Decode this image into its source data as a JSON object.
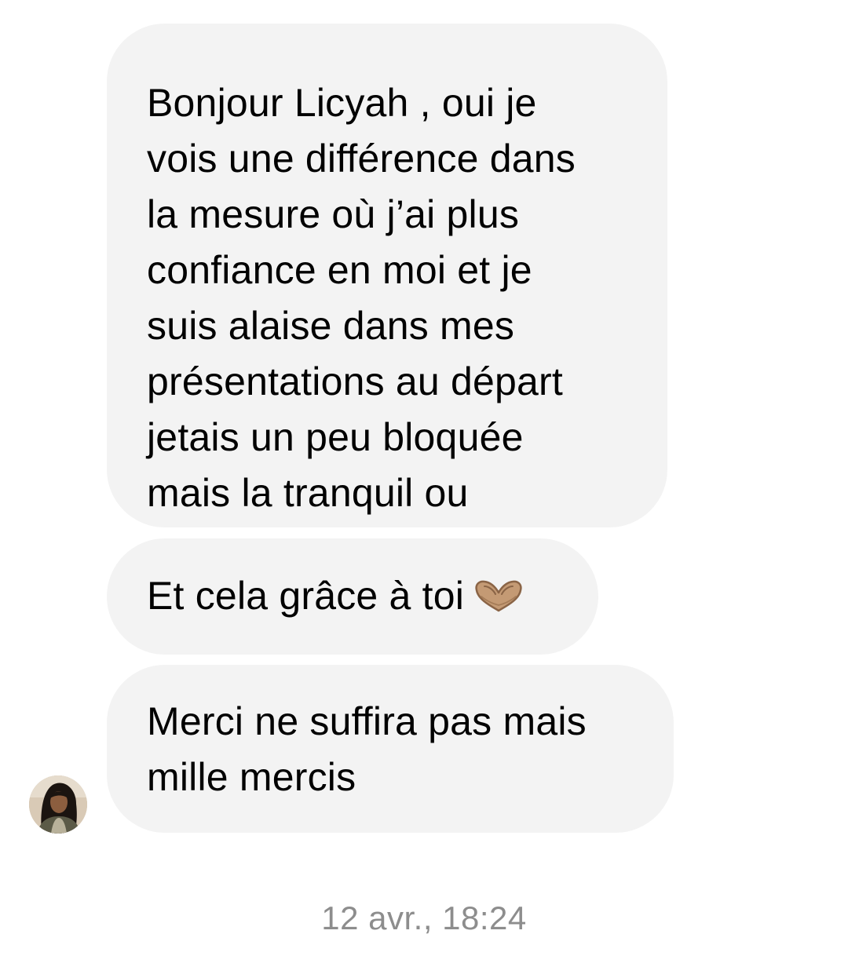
{
  "messages": [
    {
      "lines": [
        "Bonjour Licyah , oui je",
        "vois une différence dans",
        "la mesure où j’ai plus",
        "confiance en moi et je",
        "suis alaise dans mes",
        "présentations au départ",
        "jetais un peu bloquée",
        "mais la tranquil ou"
      ]
    },
    {
      "text": "Et cela grâce à toi",
      "icon": "heart-hands-icon"
    },
    {
      "lines": [
        "Merci ne suffira pas mais",
        "mille mercis"
      ]
    }
  ],
  "timestamp": "12 avr., 18:24",
  "colors": {
    "bubble_background": "#f3f3f3",
    "timestamp_text": "#8d8d8d"
  }
}
